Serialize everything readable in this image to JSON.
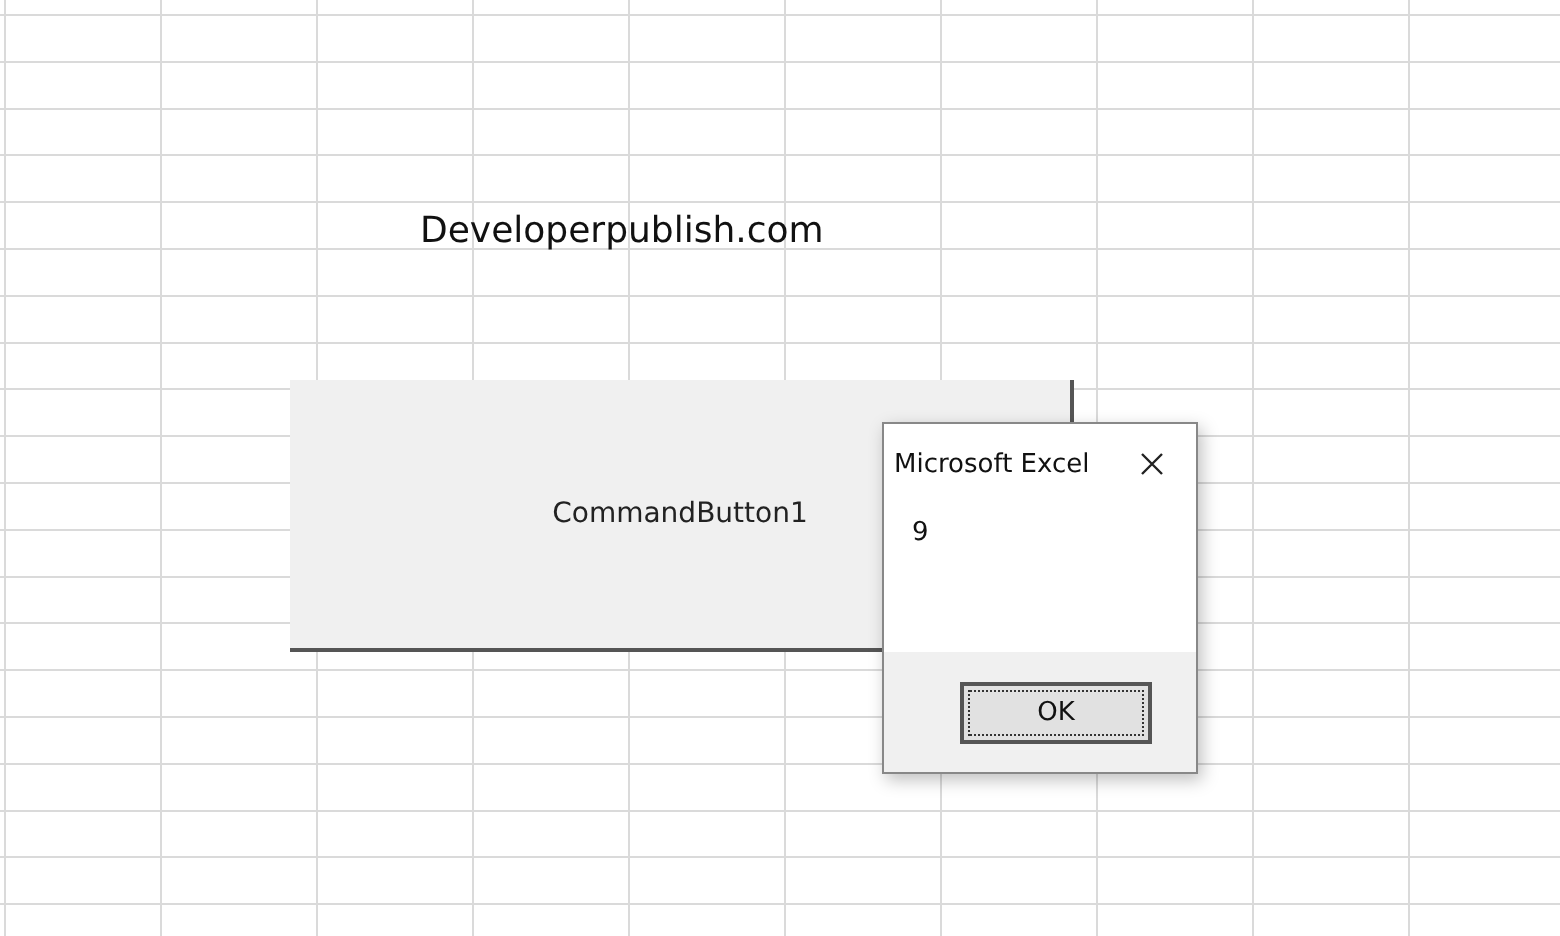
{
  "sheet": {
    "cell_text": "Developerpublish.com"
  },
  "command_button": {
    "label": "CommandButton1"
  },
  "dialog": {
    "title": "Microsoft Excel",
    "message": "9",
    "buttons": [
      {
        "label": "OK",
        "focused": true
      }
    ]
  }
}
